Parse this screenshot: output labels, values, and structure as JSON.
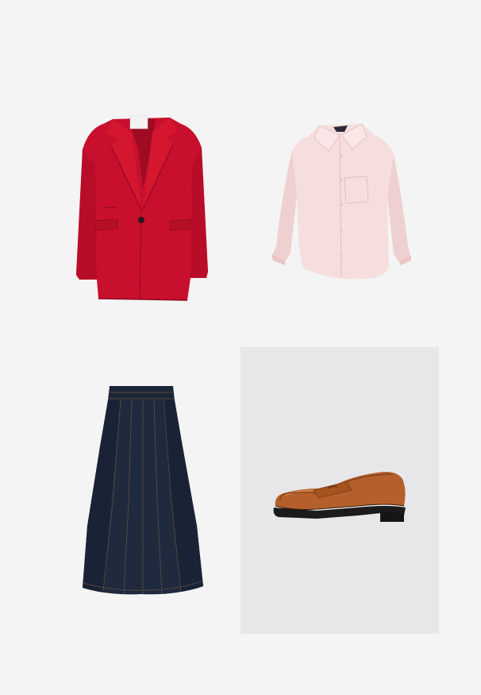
{
  "board": {
    "background": "#f4f4f4",
    "items": [
      {
        "name": "red-blazer",
        "color": "#c8102e"
      },
      {
        "name": "pink-shirt",
        "color": "#f6dcdc"
      },
      {
        "name": "denim-skirt",
        "color": "#1f2a3f"
      },
      {
        "name": "tan-loafer",
        "color": "#b5602c",
        "panel_color": "#e7e7e9"
      }
    ]
  }
}
